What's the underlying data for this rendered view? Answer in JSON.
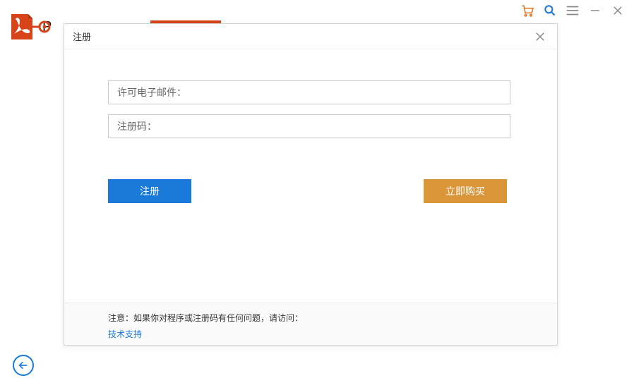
{
  "app": {
    "name_partial": "P"
  },
  "modal": {
    "title": "注册",
    "email_placeholder": "许可电子邮件：",
    "code_placeholder": "注册码：",
    "register_btn": "注册",
    "buy_btn": "立即购买",
    "footer_note": "注意：如果你对程序或注册码有任何问题，请访问：",
    "footer_link": "技术支持"
  }
}
